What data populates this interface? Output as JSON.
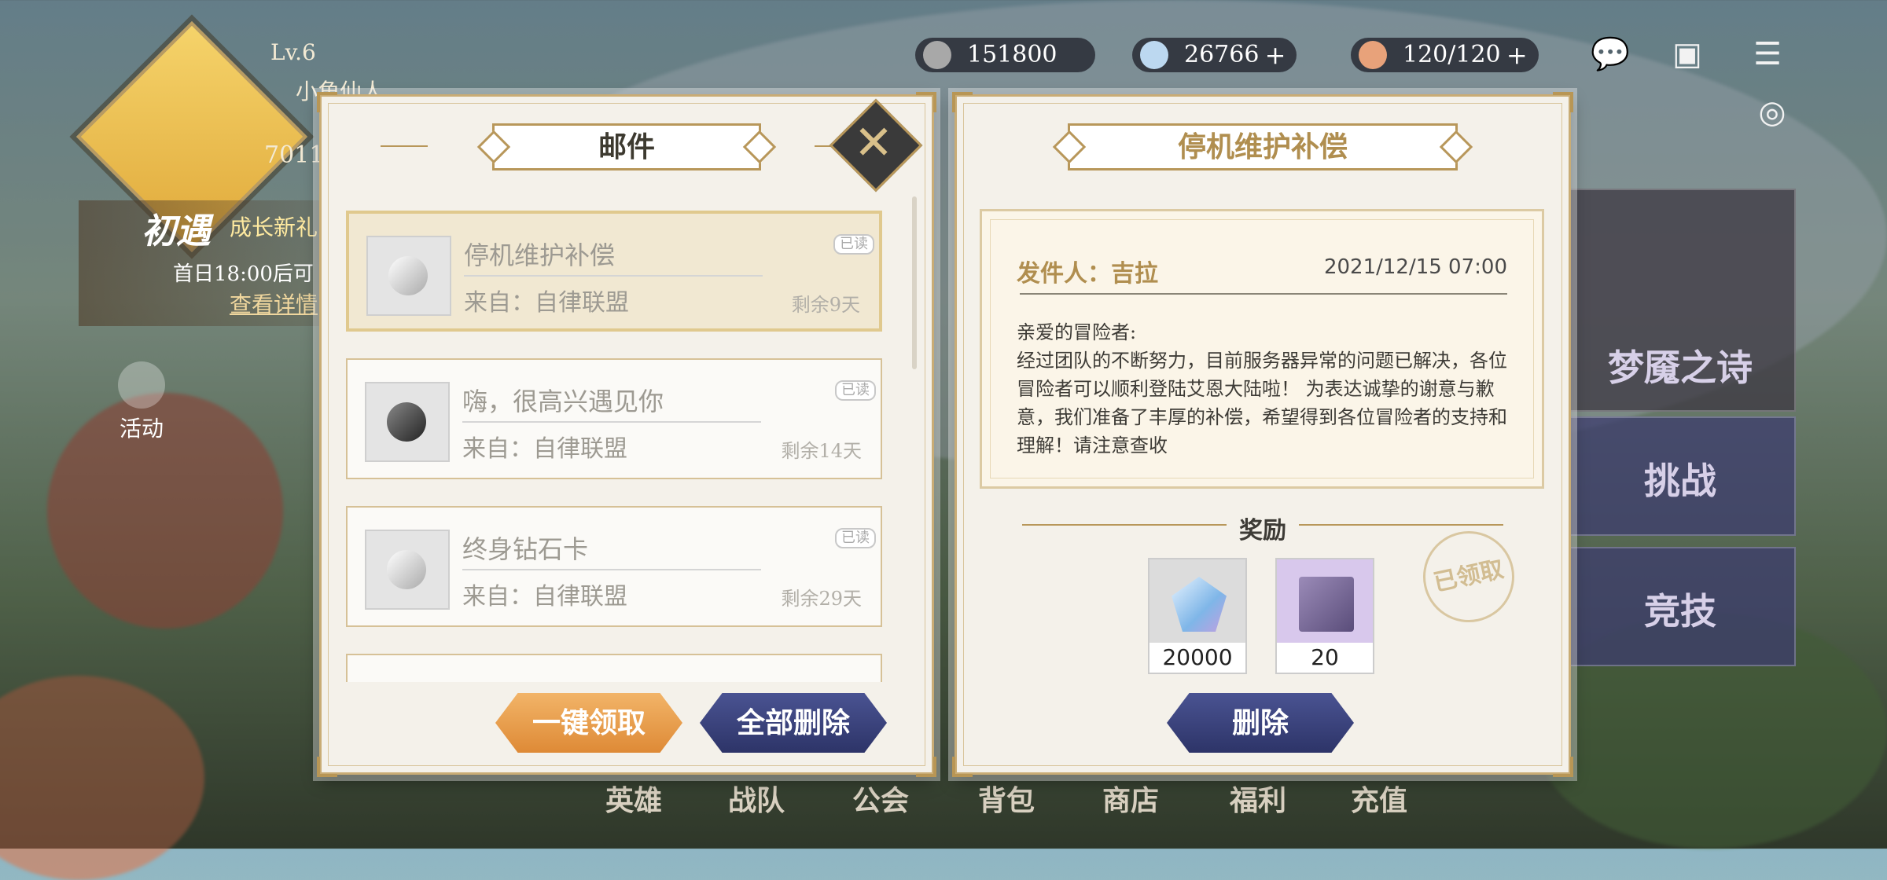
{
  "player": {
    "level": "Lv.6",
    "name": "小角仙人",
    "uid": "7011"
  },
  "currencies": {
    "gold": "151800",
    "diamond": "26766",
    "stamina": "120/120"
  },
  "promo": {
    "title": "初遇",
    "subtitle": "成长新礼",
    "time": "首日18:00后可",
    "link": "查看详情"
  },
  "activity_label": "活动",
  "side_cards": [
    "梦魇之诗",
    "挑战",
    "竞技"
  ],
  "bottom_nav": [
    "英雄",
    "战队",
    "公会",
    "背包",
    "商店",
    "福利",
    "充值"
  ],
  "mail_panel": {
    "title": "邮件",
    "items": [
      {
        "title": "停机维护补偿",
        "from": "来自：自律联盟",
        "remaining": "剩余9天",
        "badge": "已读"
      },
      {
        "title": "嗨，很高兴遇见你",
        "from": "来自：自律联盟",
        "remaining": "剩余14天",
        "badge": "已读"
      },
      {
        "title": "终身钻石卡",
        "from": "来自：自律联盟",
        "remaining": "剩余29天",
        "badge": "已读"
      }
    ],
    "claim_all_label": "一键领取",
    "delete_all_label": "全部删除"
  },
  "detail_panel": {
    "title": "停机维护补偿",
    "sender": "发件人：吉拉",
    "date": "2021/12/15 07:00",
    "greeting": "亲爱的冒险者:",
    "body": "经过团队的不断努力，目前服务器异常的问题已解决，各位冒险者可以顺利登陆艾恩大陆啦！ 为表达诚挚的谢意与歉意，我们准备了丰厚的补偿，希望得到各位冒险者的支持和理解！请注意查收",
    "reward_label": "奖励",
    "rewards": [
      {
        "icon": "diamond-icon",
        "count": "20000"
      },
      {
        "icon": "card-icon",
        "count": "20"
      }
    ],
    "claimed_stamp": "已领取",
    "delete_label": "删除"
  }
}
